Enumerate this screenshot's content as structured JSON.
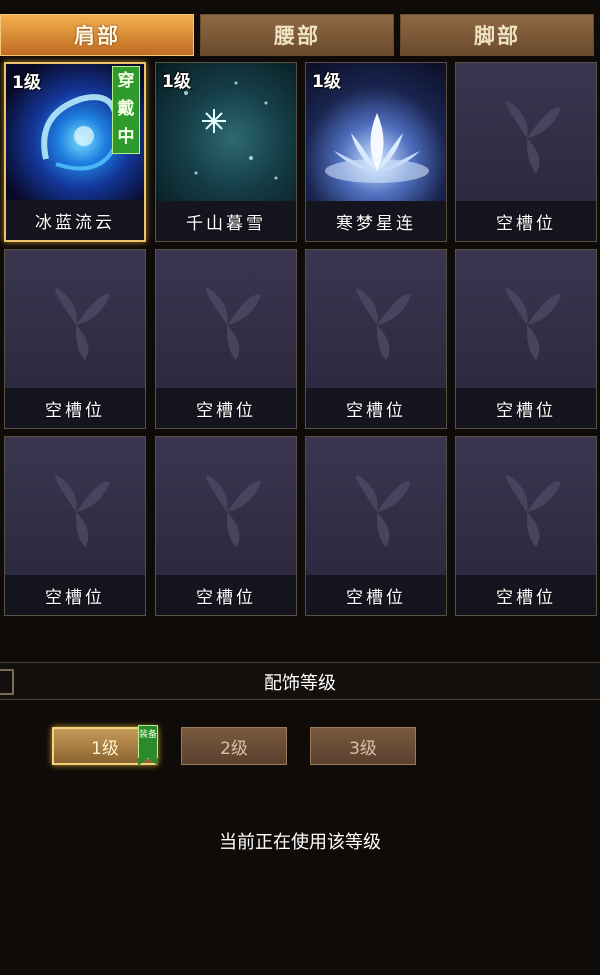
{
  "tabs": [
    {
      "label": "肩部",
      "active": true
    },
    {
      "label": "腰部",
      "active": false
    },
    {
      "label": "脚部",
      "active": false
    }
  ],
  "slots": [
    {
      "name": "冰蓝流云",
      "level": "1级",
      "equipped": true,
      "badge": "穿戴中",
      "art": "blue-swirl-icon"
    },
    {
      "name": "千山暮雪",
      "level": "1级",
      "equipped": false,
      "art": "snowflake-icon"
    },
    {
      "name": "寒梦星连",
      "level": "1级",
      "equipped": false,
      "art": "lotus-icon"
    },
    {
      "name": "空槽位",
      "empty": true
    },
    {
      "name": "空槽位",
      "empty": true
    },
    {
      "name": "空槽位",
      "empty": true
    },
    {
      "name": "空槽位",
      "empty": true
    },
    {
      "name": "空槽位",
      "empty": true
    },
    {
      "name": "空槽位",
      "empty": true
    },
    {
      "name": "空槽位",
      "empty": true
    },
    {
      "name": "空槽位",
      "empty": true
    },
    {
      "name": "空槽位",
      "empty": true
    }
  ],
  "accessory_level": {
    "title": "配饰等级",
    "buttons": [
      {
        "label": "1级",
        "active": true
      },
      {
        "label": "2级",
        "active": false
      },
      {
        "label": "3级",
        "active": false
      }
    ],
    "equip_tag": "装备",
    "status": "当前正在使用该等级"
  },
  "colors": {
    "active_tab": "#e8993c",
    "inactive_tab": "#7d5a3a",
    "slot_bg": "#2f2c44",
    "equipped_border": "#e9c36a",
    "badge_green": "#2f9a2c"
  }
}
